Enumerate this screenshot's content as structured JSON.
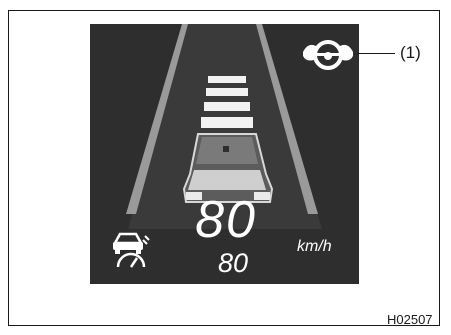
{
  "screen": {
    "speed_display": "80",
    "set_speed": "80",
    "speed_unit": "km/h",
    "colors": {
      "background": "#2e2e2e",
      "lane_marker": "#ffffff",
      "vehicle": "#cfcfcf"
    },
    "icons": {
      "steering_assist": "steering-wheel-hands-icon",
      "cruise": "vehicle-speedometer-icon"
    }
  },
  "callout": {
    "label": "(1)"
  },
  "reference_code": "H02507"
}
